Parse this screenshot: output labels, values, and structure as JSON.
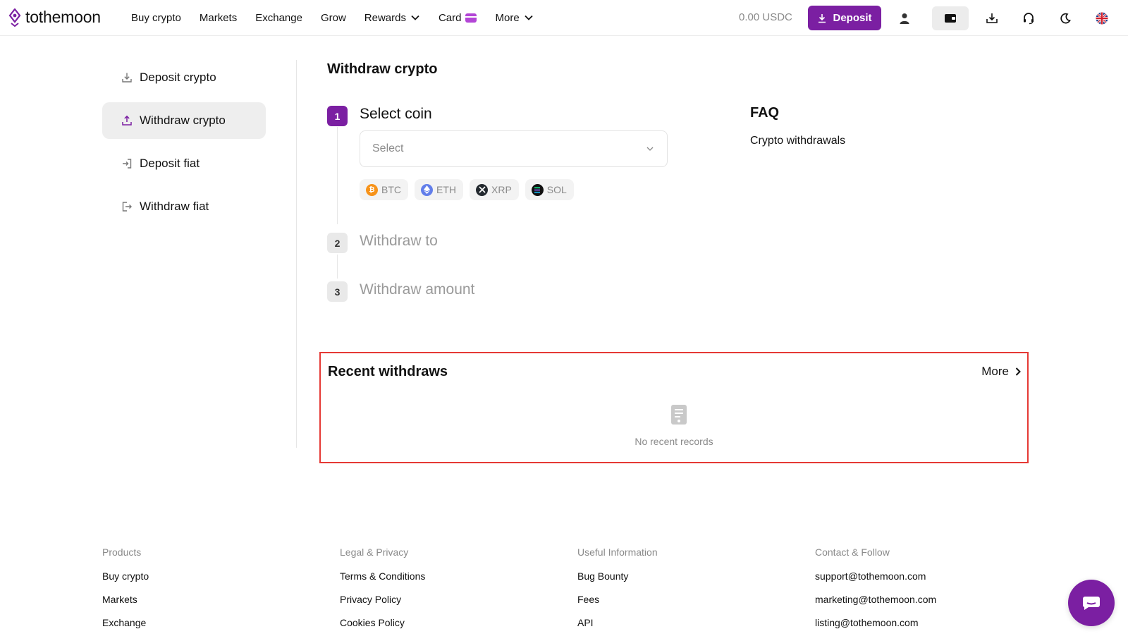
{
  "header": {
    "logo_text": "tothemoon",
    "nav": {
      "buy_crypto": "Buy crypto",
      "markets": "Markets",
      "exchange": "Exchange",
      "grow": "Grow",
      "rewards": "Rewards",
      "card": "Card",
      "more": "More"
    },
    "balance": "0.00 USDC",
    "deposit_label": "Deposit",
    "icons": [
      "user-icon",
      "wallet-icon",
      "download-icon",
      "headset-icon",
      "moon-icon",
      "uk-flag-icon"
    ]
  },
  "sidebar": {
    "items": [
      {
        "label": "Deposit crypto",
        "icon": "download-icon"
      },
      {
        "label": "Withdraw crypto",
        "icon": "upload-icon",
        "active": true
      },
      {
        "label": "Deposit fiat",
        "icon": "sign-in-icon"
      },
      {
        "label": "Withdraw fiat",
        "icon": "sign-out-icon"
      }
    ]
  },
  "main": {
    "title": "Withdraw crypto",
    "steps": [
      {
        "number": "1",
        "label": "Select coin"
      },
      {
        "number": "2",
        "label": "Withdraw to"
      },
      {
        "number": "3",
        "label": "Withdraw amount"
      }
    ],
    "select_placeholder": "Select",
    "coins": [
      {
        "symbol": "BTC",
        "color": "#f7931a"
      },
      {
        "symbol": "ETH",
        "color": "#627eea"
      },
      {
        "symbol": "XRP",
        "color": "#23292f"
      },
      {
        "symbol": "SOL",
        "color": "#14f195"
      }
    ]
  },
  "faq": {
    "title": "FAQ",
    "link": "Crypto withdrawals"
  },
  "recent": {
    "title": "Recent withdraws",
    "more_label": "More",
    "empty_text": "No recent records"
  },
  "footer": {
    "products": {
      "heading": "Products",
      "links": [
        "Buy crypto",
        "Markets",
        "Exchange"
      ]
    },
    "legal": {
      "heading": "Legal & Privacy",
      "links": [
        "Terms & Conditions",
        "Privacy Policy",
        "Cookies Policy"
      ]
    },
    "useful": {
      "heading": "Useful Information",
      "links": [
        "Bug Bounty",
        "Fees",
        "API"
      ]
    },
    "contact": {
      "heading": "Contact & Follow",
      "links": [
        "support@tothemoon.com",
        "marketing@tothemoon.com",
        "listing@tothemoon.com"
      ]
    }
  },
  "colors": {
    "accent": "#7b1fa2",
    "highlight_border": "#e53935"
  }
}
